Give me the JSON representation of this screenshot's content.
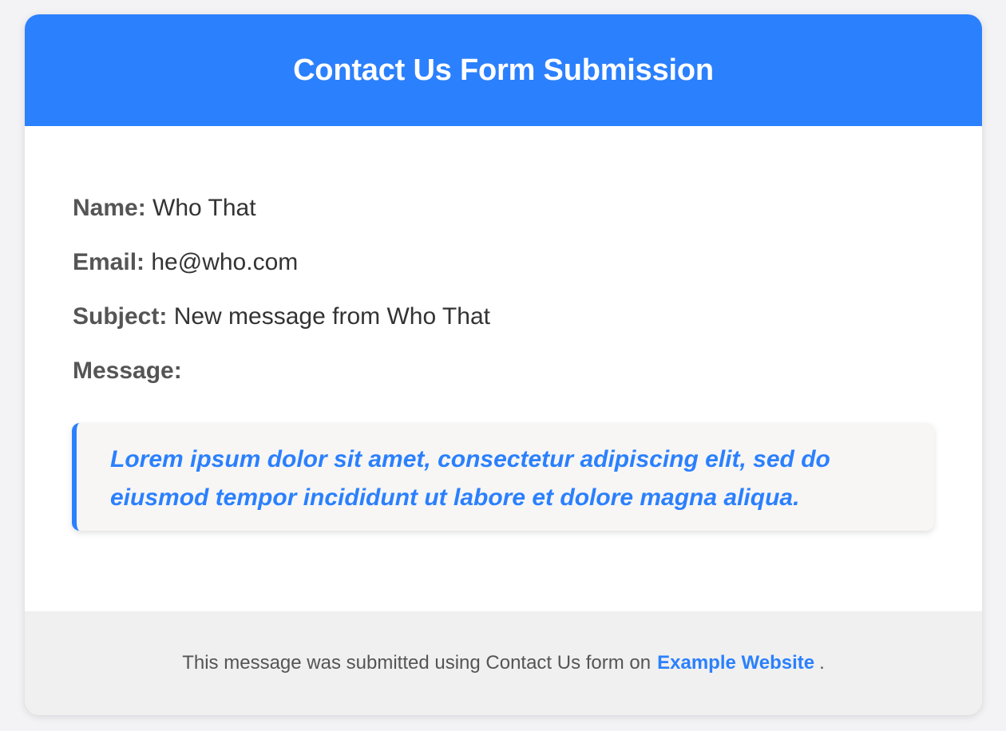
{
  "colors": {
    "accent": "#2b80fd",
    "background": "#f3f3f6",
    "footer_bg": "#f0f0f0",
    "quote_bg": "#f7f6f5"
  },
  "header": {
    "title": "Contact Us Form Submission"
  },
  "fields": {
    "name_label": "Name:",
    "name_value": "Who That",
    "email_label": "Email:",
    "email_value": "he@who.com",
    "subject_label": "Subject:",
    "subject_value": "New message from Who That",
    "message_label": "Message:"
  },
  "message": {
    "text": "Lorem ipsum dolor sit amet, consectetur adipiscing elit, sed do eiusmod tempor incididunt ut labore et dolore magna aliqua."
  },
  "footer": {
    "prefix": "This message was submitted using Contact Us form on",
    "link_text": "Example Website",
    "suffix": "."
  }
}
